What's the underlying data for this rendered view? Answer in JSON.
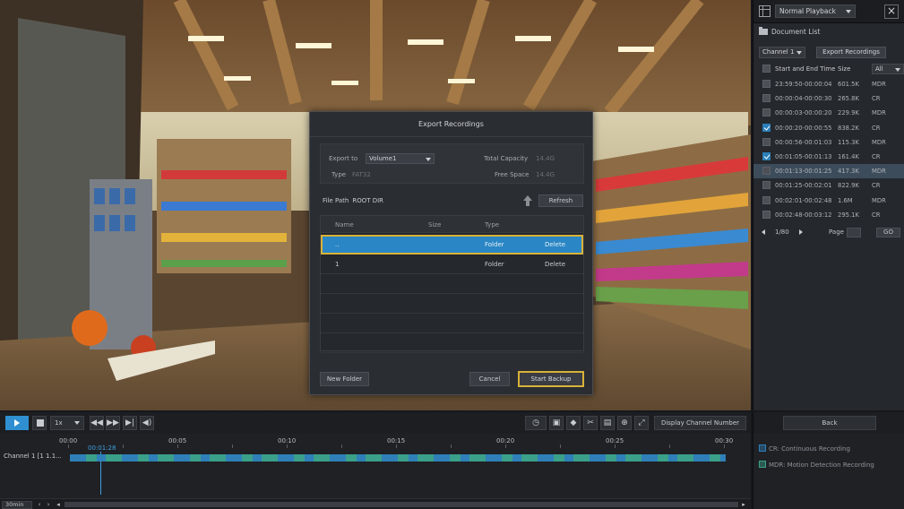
{
  "right_panel": {
    "playback_mode": "Normal Playback",
    "document_list_label": "Document List",
    "channel_select": "Channel 1",
    "export_recordings_button": "Export Recordings",
    "header_time": "Start and End Time",
    "header_size": "Size",
    "size_filter": "All",
    "records": [
      {
        "time": "23:59:50-00:00:04",
        "size": "601.5K",
        "type": "MDR",
        "checked": false,
        "selected": false
      },
      {
        "time": "00:00:04-00:00:30",
        "size": "265.8K",
        "type": "CR",
        "checked": false,
        "selected": false
      },
      {
        "time": "00:00:03-00:00:20",
        "size": "229.9K",
        "type": "MDR",
        "checked": false,
        "selected": false
      },
      {
        "time": "00:00:20-00:00:55",
        "size": "838.2K",
        "type": "CR",
        "checked": true,
        "selected": false
      },
      {
        "time": "00:00:56-00:01:03",
        "size": "115.3K",
        "type": "MDR",
        "checked": false,
        "selected": false
      },
      {
        "time": "00:01:05-00:01:13",
        "size": "161.4K",
        "type": "CR",
        "checked": true,
        "selected": false
      },
      {
        "time": "00:01:13-00:01:25",
        "size": "417.3K",
        "type": "MDR",
        "checked": false,
        "selected": true
      },
      {
        "time": "00:01:25-00:02:01",
        "size": "822.9K",
        "type": "CR",
        "checked": false,
        "selected": false
      },
      {
        "time": "00:02:01-00:02:48",
        "size": "1.6M",
        "type": "MDR",
        "checked": false,
        "selected": false
      },
      {
        "time": "00:02:48-00:03:12",
        "size": "295.1K",
        "type": "CR",
        "checked": false,
        "selected": false
      }
    ],
    "page_indicator": "1/80",
    "page_label": "Page",
    "go_button": "GO",
    "back_button": "Back"
  },
  "toolbar": {
    "speed": "1x",
    "display_channel_button": "Display Channel Number"
  },
  "timeline": {
    "ticks": [
      "00:00",
      "00:05",
      "00:10",
      "00:15",
      "00:20",
      "00:25",
      "00:30"
    ],
    "cursor_time": "00:01:28",
    "channel_label": "Channel 1 [1 1.1...",
    "zoom": "30min"
  },
  "legend": {
    "continuous": "CR: Continuous Recording",
    "motion": "MDR: Motion Detection Recording"
  },
  "modal": {
    "title": "Export Recordings",
    "export_to_label": "Export to",
    "export_to_value": "Volume1",
    "type_label": "Type",
    "type_value": "FAT32",
    "total_capacity_label": "Total Capacity",
    "total_capacity_value": "14.4G",
    "free_space_label": "Free Space",
    "free_space_value": "14.4G",
    "file_path_label": "File Path",
    "file_path_value": "ROOT DIR",
    "refresh_button": "Refresh",
    "col_name": "Name",
    "col_size": "Size",
    "col_type": "Type",
    "rows": [
      {
        "name": "..",
        "size": "",
        "type": "Folder",
        "action": "Delete"
      },
      {
        "name": "1",
        "size": "",
        "type": "Folder",
        "action": "Delete"
      }
    ],
    "new_folder_button": "New Folder",
    "cancel_button": "Cancel",
    "start_backup_button": "Start Backup"
  }
}
